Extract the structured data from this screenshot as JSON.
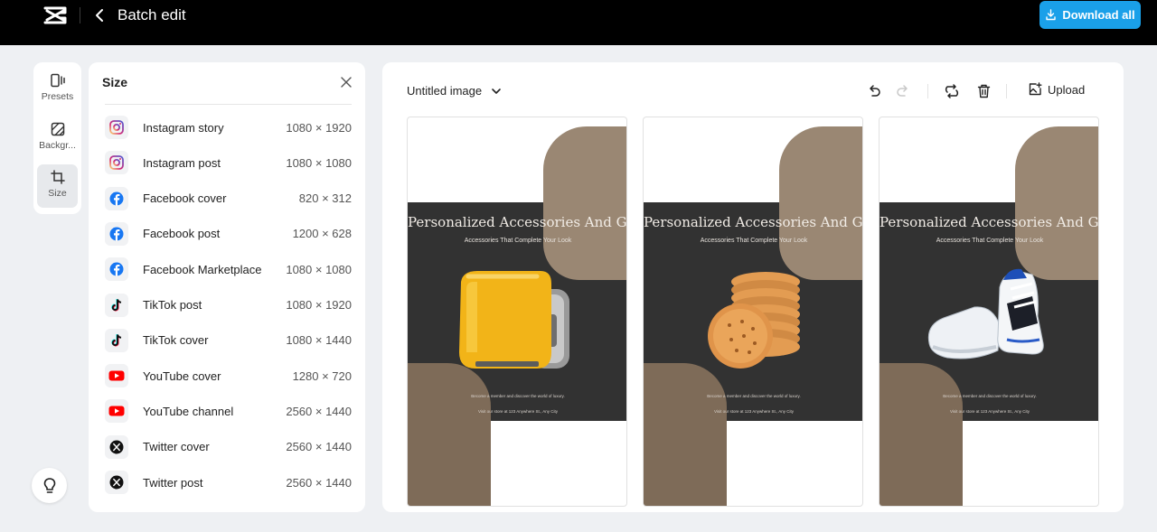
{
  "header": {
    "title": "Batch edit",
    "download_label": "Download all",
    "accent": "#1aa0e9"
  },
  "rail": {
    "items": [
      {
        "label": "Presets",
        "icon": "presets-icon"
      },
      {
        "label": "Backgr...",
        "icon": "background-icon"
      },
      {
        "label": "Size",
        "icon": "crop-icon",
        "active": true
      }
    ]
  },
  "size_panel": {
    "title": "Size",
    "items": [
      {
        "name": "Instagram story",
        "dims": "1080 × 1920",
        "icon": "instagram-icon"
      },
      {
        "name": "Instagram post",
        "dims": "1080 × 1080",
        "icon": "instagram-icon"
      },
      {
        "name": "Facebook cover",
        "dims": "820 × 312",
        "icon": "facebook-icon"
      },
      {
        "name": "Facebook post",
        "dims": "1200 × 628",
        "icon": "facebook-icon"
      },
      {
        "name": "Facebook Marketplace",
        "dims": "1080 × 1080",
        "icon": "facebook-icon"
      },
      {
        "name": "TikTok post",
        "dims": "1080 × 1920",
        "icon": "tiktok-icon"
      },
      {
        "name": "TikTok cover",
        "dims": "1080 × 1440",
        "icon": "tiktok-icon"
      },
      {
        "name": "YouTube cover",
        "dims": "1280 × 720",
        "icon": "youtube-icon"
      },
      {
        "name": "YouTube channel",
        "dims": "2560 × 1440",
        "icon": "youtube-icon"
      },
      {
        "name": "Twitter cover",
        "dims": "2560 × 1440",
        "icon": "twitter-x-icon"
      },
      {
        "name": "Twitter post",
        "dims": "2560 × 1440",
        "icon": "twitter-x-icon"
      }
    ]
  },
  "canvas": {
    "file_name": "Untitled image",
    "upload_label": "Upload",
    "cards": [
      {
        "headline": "Personalized Accessories And Gifts",
        "subtitle": "Accessories That Complete Your Look",
        "footer_line1": "Become a member and discover the world of luxury.",
        "footer_line2": "Visit our store at 123 Anywhere St., Any City",
        "product": "toaster",
        "caption": ""
      },
      {
        "headline": "Personalized Accessories And Gifts",
        "subtitle": "Accessories That Complete Your Look",
        "footer_line1": "Become a member and discover the world of luxury.",
        "footer_line2": "Visit our store at 123 Anywhere St., Any City",
        "product": "biscuits",
        "caption": ""
      },
      {
        "headline": "Personalized Accessories And Gifts",
        "subtitle": "Accessories That Complete Your Look",
        "footer_line1": "Become a member and discover the world of luxury.",
        "footer_line2": "Visit our store at 123 Anywhere St., Any City",
        "product": "sneaker",
        "caption": ""
      }
    ]
  }
}
